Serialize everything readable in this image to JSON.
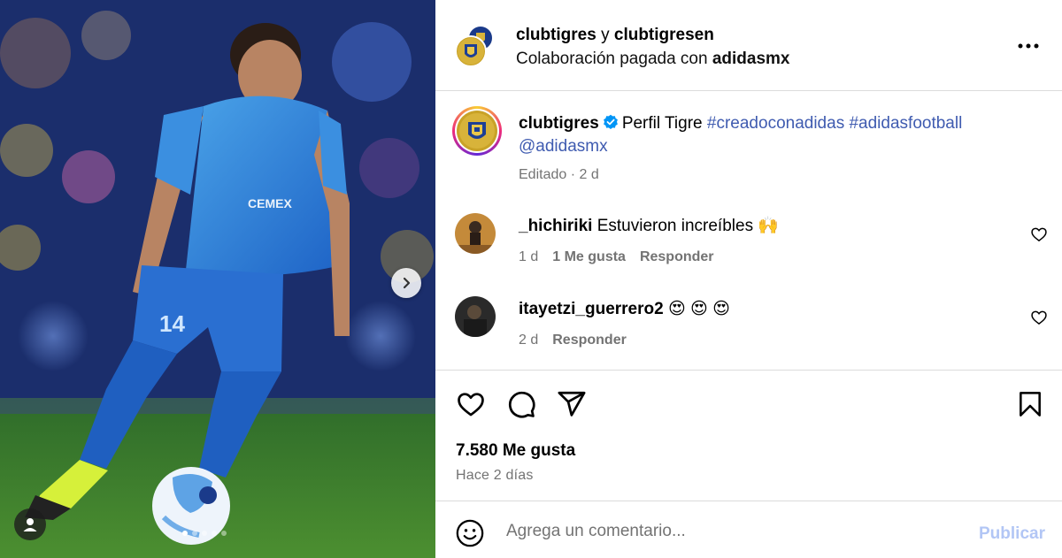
{
  "header": {
    "user1": "clubtigres",
    "connector": "y",
    "user2": "clubtigresen",
    "collab_prefix": "Colaboración pagada con",
    "collab_brand": "adidasmx",
    "more_icon": "more-horizontal-icon"
  },
  "caption": {
    "username": "clubtigres",
    "verified_icon": "verified-badge-icon",
    "text": "Perfil Tigre",
    "hashtag1": "#creadoconadidas",
    "hashtag2": "#adidasfootball",
    "mention": "@adidasmx",
    "edited": "Editado",
    "separator": "·",
    "time": "2 d"
  },
  "comments": [
    {
      "username": "_hichiriki",
      "text": "Estuvieron increíbles",
      "emoji": "🙌",
      "time": "1 d",
      "likes": "1 Me gusta",
      "reply": "Responder"
    },
    {
      "username": "itayetzi_guerrero2",
      "text": "",
      "emoji": "😍 😍 😍",
      "time": "2 d",
      "reply": "Responder"
    }
  ],
  "actions": {
    "likes": "7.580 Me gusta",
    "posted": "Hace 2 días",
    "icons": [
      "heart-icon",
      "comment-icon",
      "share-icon",
      "bookmark-icon"
    ]
  },
  "composer": {
    "placeholder": "Agrega un comentario...",
    "publish": "Publicar"
  },
  "colors": {
    "link": "#3f5bb0",
    "muted": "#737373",
    "publish_disabled": "#b2c6f5",
    "divider": "#dbdbdb"
  }
}
